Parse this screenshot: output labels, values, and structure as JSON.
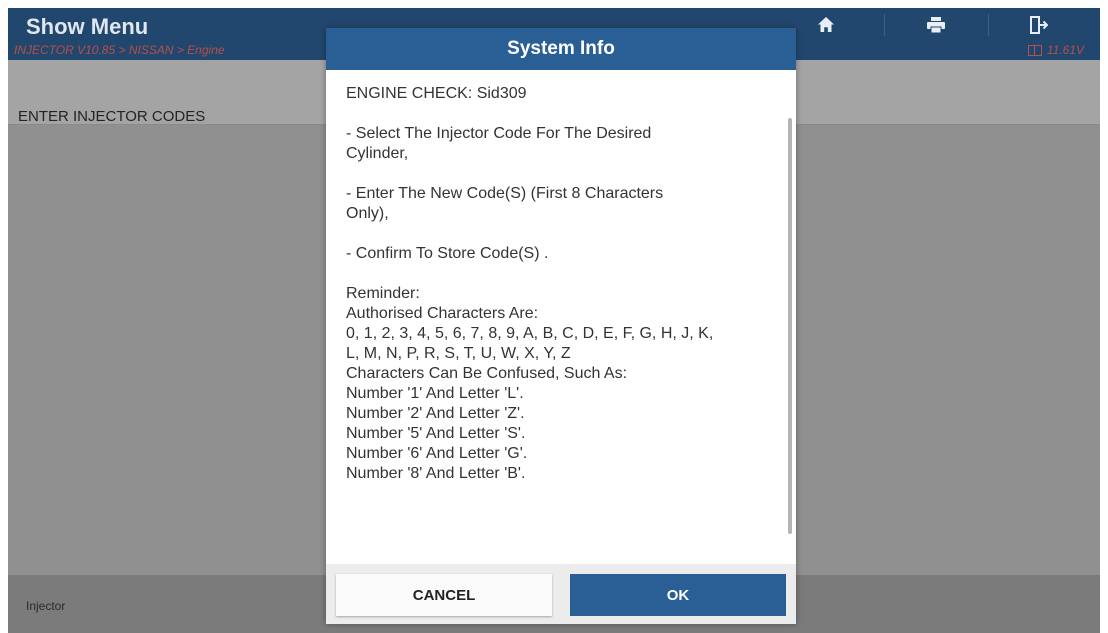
{
  "header": {
    "title": "Show Menu",
    "breadcrumb": "INJECTOR V10.85 > NISSAN > Engine",
    "voltage": "11.61V",
    "toolbar_icons": [
      "home-icon",
      "print-icon",
      "exit-icon"
    ]
  },
  "subheader": {
    "title": "ENTER INJECTOR CODES"
  },
  "footer": {
    "label": "Injector"
  },
  "dialog": {
    "title": "System Info",
    "paragraphs": [
      [
        "ENGINE CHECK: Sid309"
      ],
      [
        "- Select The Injector Code For The Desired",
        "Cylinder,"
      ],
      [
        "- Enter The New Code(S) (First 8 Characters",
        "Only),"
      ],
      [
        "- Confirm To Store Code(S) ."
      ],
      [
        "Reminder:",
        "Authorised Characters Are:",
        "0, 1, 2, 3, 4, 5, 6, 7, 8, 9, A, B, C, D, E, F, G, H, J, K,",
        "L, M, N, P, R, S, T, U, W, X, Y, Z",
        "Characters Can Be Confused, Such As:",
        "Number '1' And Letter 'L'.",
        "Number '2' And Letter 'Z'.",
        "Number '5' And Letter 'S'.",
        "Number '6' And Letter 'G'.",
        "Number '8' And Letter 'B'."
      ]
    ],
    "cancel_label": "CANCEL",
    "ok_label": "OK"
  },
  "colors": {
    "header_bg": "#22476e",
    "accent": "#2a5f95",
    "breadcrumb_text": "#b5504a",
    "backdrop": "#909090"
  }
}
